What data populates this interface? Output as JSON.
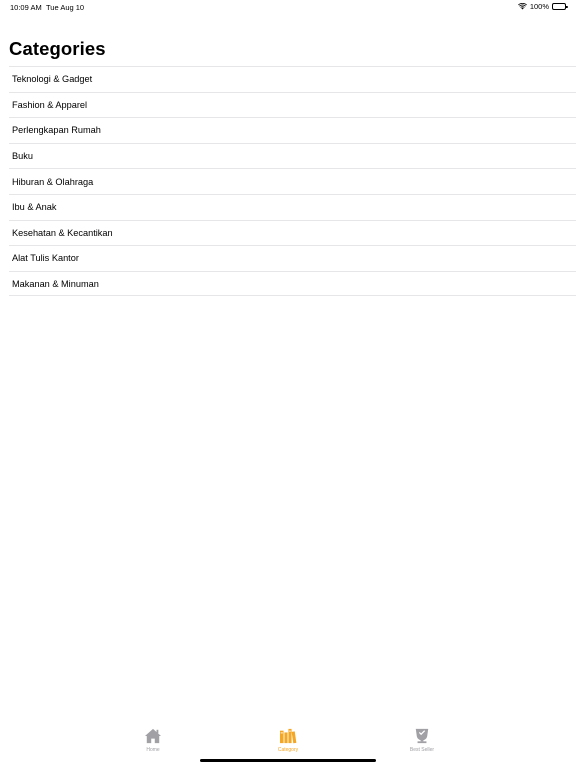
{
  "status_bar": {
    "time": "10:09 AM",
    "date": "Tue Aug 10",
    "battery": "100%"
  },
  "page": {
    "title": "Categories"
  },
  "categories": [
    {
      "label": "Teknologi & Gadget"
    },
    {
      "label": "Fashion & Apparel"
    },
    {
      "label": "Perlengkapan Rumah"
    },
    {
      "label": "Buku"
    },
    {
      "label": "Hiburan & Olahraga"
    },
    {
      "label": "Ibu & Anak"
    },
    {
      "label": "Kesehatan & Kecantikan"
    },
    {
      "label": "Alat Tulis Kantor"
    },
    {
      "label": "Makanan & Minuman"
    }
  ],
  "tab_bar": {
    "tabs": [
      {
        "label": "Home",
        "icon": "home-icon",
        "active": false
      },
      {
        "label": "Category",
        "icon": "books-icon",
        "active": true
      },
      {
        "label": "Best Seller",
        "icon": "trophy-icon",
        "active": false
      }
    ]
  },
  "colors": {
    "accent": "#f5a623",
    "inactive_tab": "#a0a0a5",
    "separator": "#e6e6e8"
  }
}
